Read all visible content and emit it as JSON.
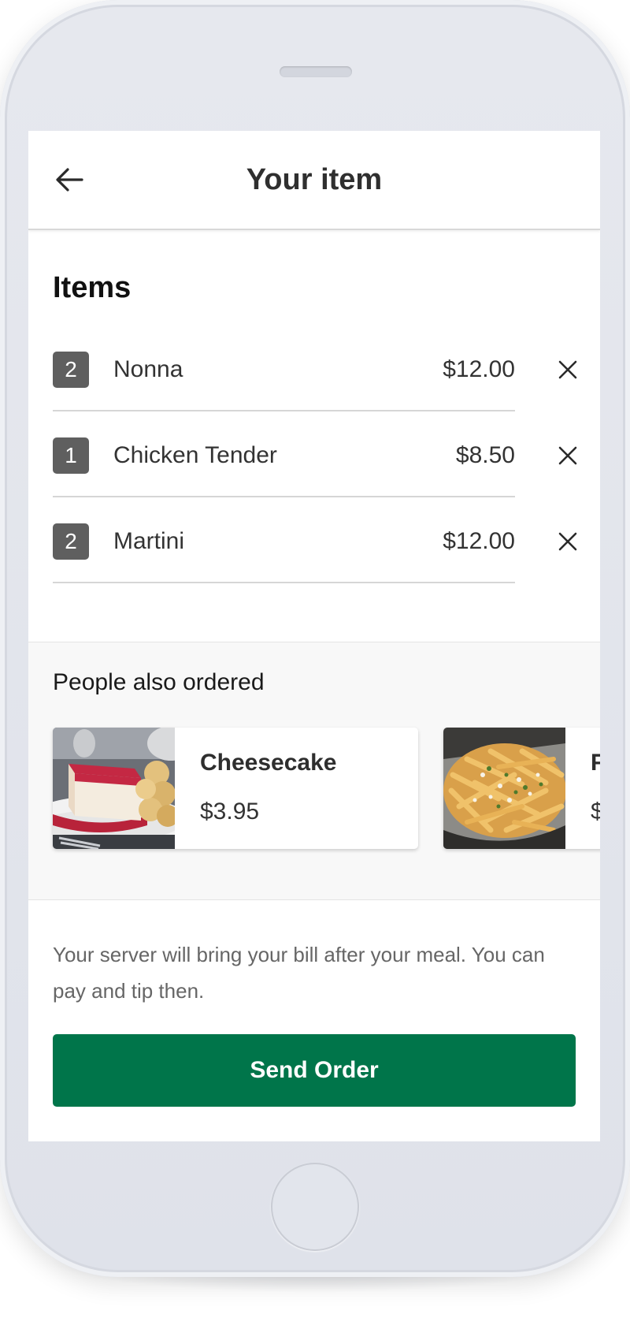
{
  "header": {
    "back_icon": "arrow-left-icon",
    "title": "Your item"
  },
  "items_section": {
    "heading": "Items",
    "items": [
      {
        "qty": "2",
        "name": "Nonna",
        "price": "$12.00",
        "remove_icon": "close-icon"
      },
      {
        "qty": "1",
        "name": "Chicken Tender",
        "price": "$8.50",
        "remove_icon": "close-icon"
      },
      {
        "qty": "2",
        "name": "Martini",
        "price": "$12.00",
        "remove_icon": "close-icon"
      }
    ]
  },
  "suggestions": {
    "heading": "People also ordered",
    "cards": [
      {
        "name": "Cheesecake",
        "price": "$3.95",
        "image": "cheesecake-photo"
      },
      {
        "name": "F",
        "price": "$",
        "image": "fries-photo"
      }
    ]
  },
  "footer": {
    "note": "Your server will bring your bill after your meal. You can pay and tip then.",
    "send_label": "Send Order"
  },
  "colors": {
    "primary_button": "#00754a",
    "qty_badge": "#5f5f5f",
    "device_frame": "#e2e5ec"
  }
}
